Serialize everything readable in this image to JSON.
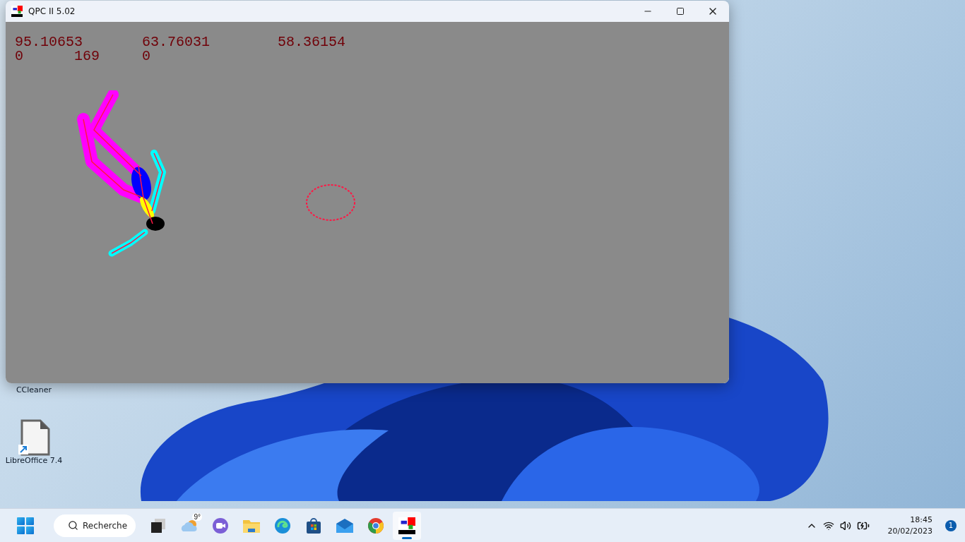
{
  "window": {
    "title": "QPC II 5.02"
  },
  "screen": {
    "lines": [
      "95.10653       63.76031        58.36154",
      "0      169     0"
    ]
  },
  "desktop_icons": [
    {
      "label": "CCleaner",
      "kind": "hidden"
    },
    {
      "label": "LibreOffice 7.4",
      "kind": "document"
    }
  ],
  "taskbar": {
    "search": {
      "placeholder": "Recherche"
    },
    "weather": {
      "temperature": "9°"
    },
    "apps": [
      {
        "kind": "taskview",
        "selected": false
      },
      {
        "kind": "weather",
        "selected": false
      },
      {
        "kind": "chat",
        "selected": false
      },
      {
        "kind": "files",
        "selected": false
      },
      {
        "kind": "edge",
        "selected": false
      },
      {
        "kind": "store",
        "selected": false
      },
      {
        "kind": "mail",
        "selected": false
      },
      {
        "kind": "chrome",
        "selected": false
      },
      {
        "kind": "qpc",
        "selected": true
      }
    ],
    "clock": {
      "time": "18:45",
      "date": "20/02/2023"
    },
    "notifications": "1"
  }
}
